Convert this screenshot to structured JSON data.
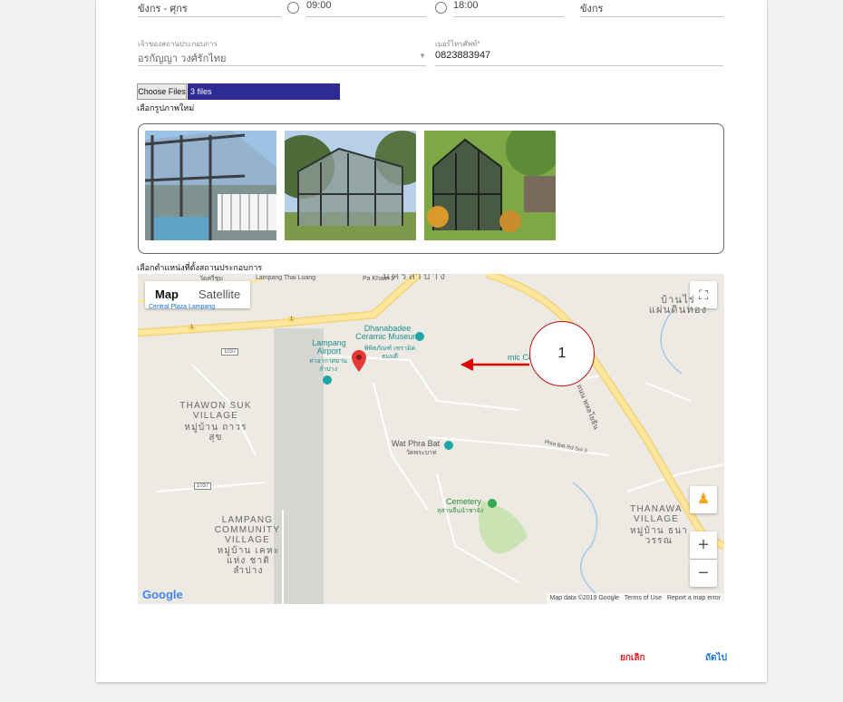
{
  "form": {
    "top_row": {
      "field1": "ขังกร - ศุกร",
      "field2": "09:00",
      "field3": "18:00",
      "field4": "ขังกร"
    },
    "owner_label": "เจ้าของสถานประกอบการ",
    "owner_value": "อรกัญญา วงศ์รักไทย",
    "phone_label": "เบอร์โทรศัพท์*",
    "phone_value": "0823883947",
    "file_button": "Choose Files",
    "file_count": "3 files",
    "new_photos_label": "เลือกรูปภาพใหม่",
    "location_label": "เลือกตำแหน่งที่ตั้งสถานประกอบการ"
  },
  "map": {
    "type_buttons": [
      "Map",
      "Satellite"
    ],
    "active_type": "Map",
    "places": {
      "ceramic_museum": "Dhanabadee Ceramic Museum",
      "ceramic_museum_th": "พิพิธภัณฑ์ เซรามิคธนบดี",
      "airport": "Lampang Airport",
      "airport_th": "ท่าอากาศยาน ลำปาง",
      "college": "mic College",
      "wat": "Wat Phra Bat",
      "wat_th": "วัดพระบาท",
      "cemetery": "Cemetery",
      "cemetery_th": "สุสานจีนนำชาจัง",
      "thawon_village": "THAWON SUK VILLAGE",
      "thawon_village_th": "หมู่บ้าน ถาวรสุข",
      "lampang_village": "LAMPANG COMMUNITY VILLAGE",
      "lampang_village_th": "หมู่บ้าน เคหะแห่ง ชาติลำปาง",
      "thanawan_village": "THANAWA VILLAGE",
      "thanawan_village_th": "หมู่บ้าน ธนาวรรณ",
      "ban_phaen": "บ้านไร่ แผ่นดินทอง",
      "top_city": "นครลำปาง",
      "central_plaza": "Central Plaza Lampang",
      "wat_top": "วัดศรีชุม",
      "road_1037a": "1037",
      "road_1037b": "1037",
      "road_1": "1",
      "road_1b": "1",
      "phra_bat_rd": "Phra Bat Rd Soi 3",
      "pa_kham": "Pa Kham 1",
      "phahonyothin": "ถนน พหลโยธิน",
      "lamp_thai": "Lampang Thai Luang"
    },
    "attribution": "Map data ©2019 Google",
    "terms": "Terms of Use",
    "report": "Report a map error",
    "google_logo": "Google",
    "zoom_in": "+",
    "zoom_out": "−"
  },
  "annotation": {
    "callout_number": "1"
  },
  "actions": {
    "cancel_label": "ยกเลิก",
    "next_label": "ถัดไป"
  },
  "colors": {
    "file_bar": "#2e2b95",
    "cancel": "#e0202a",
    "next": "#1f78d1",
    "pin": "#e53935",
    "arrow": "#e00000"
  }
}
